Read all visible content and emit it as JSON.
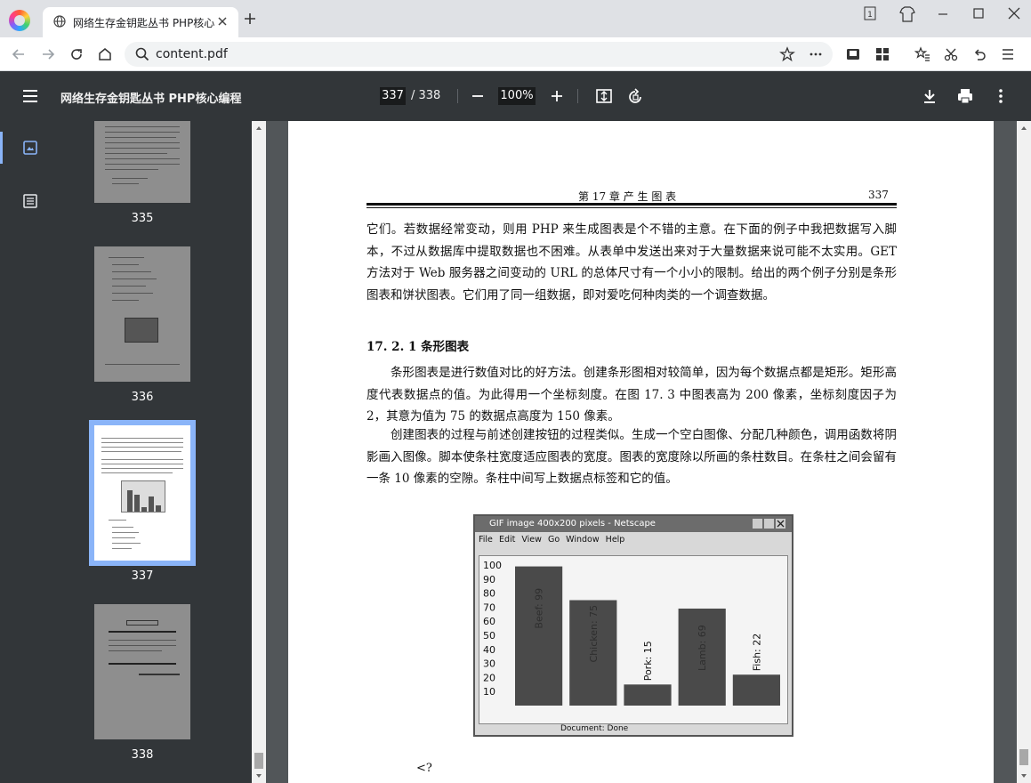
{
  "browser": {
    "tab_title": "网络生存金钥匙丛书 PHP核心",
    "url": "content.pdf"
  },
  "pdf_toolbar": {
    "title": "网络生存金钥匙丛书 PHP核心编程",
    "current_page": "337",
    "total_pages": "/ 338",
    "zoom": "100%"
  },
  "thumbnails": [
    {
      "label": "335"
    },
    {
      "label": "336"
    },
    {
      "label": "337"
    },
    {
      "label": "338"
    }
  ],
  "page": {
    "running_head": "第 17 章    产 生 图 表",
    "page_number": "337",
    "para1": "它们。若数据经常变动，则用 PHP 来生成图表是个不错的主意。在下面的例子中我把数据写入脚本，不过从数据库中提取数据也不困难。从表单中发送出来对于大量数据来说可能不太实用。GET 方法对于 Web 服务器之间变动的 URL 的总体尺寸有一个小小的限制。给出的两个例子分别是条形图表和饼状图表。它们用了同一组数据，即对爱吃何种肉类的一个调查数据。",
    "section_heading": "17. 2. 1    条形图表",
    "para2": "条形图表是进行数值对比的好方法。创建条形图相对较简单，因为每个数据点都是矩形。矩形高度代表数据点的值。为此得用一个坐标刻度。在图 17. 3 中图表高为 200 像素，坐标刻度因子为 2，其意为值为 75 的数据点高度为 150 像素。",
    "para3": "创建图表的过程与前述创建按钮的过程类似。生成一个空白图像、分配几种颜色，调用函数将阴影画入图像。脚本使条柱宽度适应图表的宽度。图表的宽度除以所画的条柱数目。在条柱之间会留有一条 10 像素的空隙。条柱中间写上数据点标签和它的值。",
    "tail_text": "<?"
  },
  "figure": {
    "window_title": "GIF image 400x200 pixels - Netscape",
    "menu": [
      "File",
      "Edit",
      "View",
      "Go",
      "Window",
      "Help"
    ],
    "status": "Document: Done",
    "axis_ticks": [
      "100",
      "90",
      "80",
      "70",
      "60",
      "50",
      "40",
      "30",
      "20",
      "10"
    ],
    "bar_labels": [
      "Beef: 99",
      "Chicken: 75",
      "Pork: 15",
      "Lamb: 69",
      "Fish: 22"
    ]
  },
  "chart_data": {
    "type": "bar",
    "categories": [
      "Beef",
      "Chicken",
      "Pork",
      "Lamb",
      "Fish"
    ],
    "values": [
      99,
      75,
      15,
      69,
      22
    ],
    "ylim": [
      0,
      100
    ]
  }
}
